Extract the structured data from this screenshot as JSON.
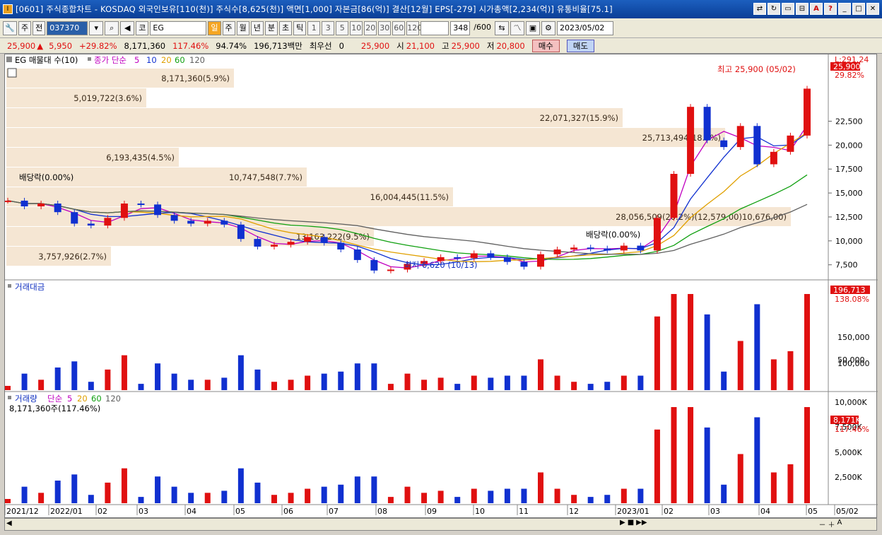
{
  "window": {
    "title": "[0601] 주식종합차트 - KOSDAQ 외국인보유[110(천)] 주식수[8,625(천)] 액면[1,000] 자본금[86(억)] 결산[12월] EPS[-279] 시가총액[2,234(억)] 유통비율[75.1]",
    "app_icon": "I"
  },
  "toolbar": {
    "mode": "주",
    "prev_label": "전",
    "stock_code": "037370",
    "market_label": "코",
    "stock_name": "EG",
    "periods": [
      "일",
      "주",
      "월",
      "년",
      "분",
      "초",
      "틱"
    ],
    "active_period": "일",
    "intervals": [
      "1",
      "3",
      "5",
      "10",
      "20",
      "30",
      "60",
      "120"
    ],
    "count_value": "348",
    "count_max": "/600",
    "date": "2023/05/02"
  },
  "quote": {
    "price": "25,900",
    "change": "5,950",
    "change_pct": "+29.82%",
    "volume": "8,171,360",
    "vol_ratio": "117.46%",
    "rate": "94.74%",
    "amount": "196,713백만",
    "best_label": "최우선",
    "best_value": "0",
    "best_price": "25,900",
    "open_label": "시",
    "open": "21,100",
    "high_label": "고",
    "high": "25,900",
    "low_label": "저",
    "low": "20,800",
    "buy_label": "매수",
    "sell_label": "매도"
  },
  "price_panel": {
    "title": "EG 매물대 수(10)",
    "ma_label": "종가 단순",
    "ma_periods": [
      "5",
      "10",
      "20",
      "60",
      "120"
    ],
    "ma_colors": [
      "#c000c0",
      "#1030d0",
      "#e0a000",
      "#10a010",
      "#606060"
    ],
    "yaxis": [
      "22,500",
      "20,000",
      "17,500",
      "15,000",
      "12,500",
      "10,000",
      "7,500"
    ],
    "top_right_label": "L:291.24",
    "current_tag": "25,900",
    "current_pct": "29.82%",
    "high_note": "최고 25,900 (05/02)",
    "low_note": "최저 6,620 (10/13)",
    "dividend_1": "배당락(0.00%)",
    "dividend_2": "배당락(0.00%)",
    "volume_profile": [
      {
        "label": "8,171,360(5.9%)"
      },
      {
        "label": "5,019,722(3.6%)"
      },
      {
        "label": "22,071,327(15.9%)"
      },
      {
        "label": "25,713,494(18.5%)"
      },
      {
        "label": "6,193,435(4.5%)"
      },
      {
        "label": "10,747,548(7.7%)"
      },
      {
        "label": "16,004,445(11.5%)"
      },
      {
        "label": "28,056,509(20.2%)(12,579,00)10,676,00)"
      },
      {
        "label": "13,163,222(9.5%)"
      },
      {
        "label": "3,757,926(2.7%)"
      }
    ]
  },
  "amount_panel": {
    "title": "거래대금",
    "yaxis": [
      "150,000",
      "100,000",
      "50,000"
    ],
    "current_tag": "196,713",
    "current_pct": "138.08%"
  },
  "volume_panel": {
    "title": "거래량",
    "ma_label": "단순",
    "ma_periods": [
      "5",
      "20",
      "60",
      "120"
    ],
    "value_line": "8,171,360주(117.46%)",
    "yaxis": [
      "10,000K",
      "7,500K",
      "5,000K",
      "2,500K"
    ],
    "current_tag": "8,171K",
    "current_pct": "117.46%"
  },
  "xaxis": [
    "2021/12",
    "2022/01",
    "02",
    "03",
    "04",
    "05",
    "06",
    "07",
    "08",
    "09",
    "10",
    "11",
    "12",
    "2023/01",
    "02",
    "03",
    "04",
    "05",
    "05/02"
  ],
  "chart_data": {
    "type": "line",
    "series": [
      {
        "values": [
          14200,
          13600,
          13900,
          13000,
          11800,
          11600,
          12400,
          13900,
          13800,
          12700,
          12100,
          11800,
          12100,
          11700,
          10200,
          9400,
          9600,
          9900,
          10400,
          9800,
          9100,
          8000,
          6900,
          7000,
          7600,
          7900,
          8300,
          8200,
          8700,
          8300,
          7800,
          7300,
          8600,
          9100,
          9300,
          9200,
          9000,
          9500,
          9000,
          12400,
          17000,
          24000,
          20500,
          19800,
          22000,
          18000,
          19300,
          21000,
          25900
        ]
      }
    ],
    "ylim": [
      6000,
      28000
    ]
  }
}
